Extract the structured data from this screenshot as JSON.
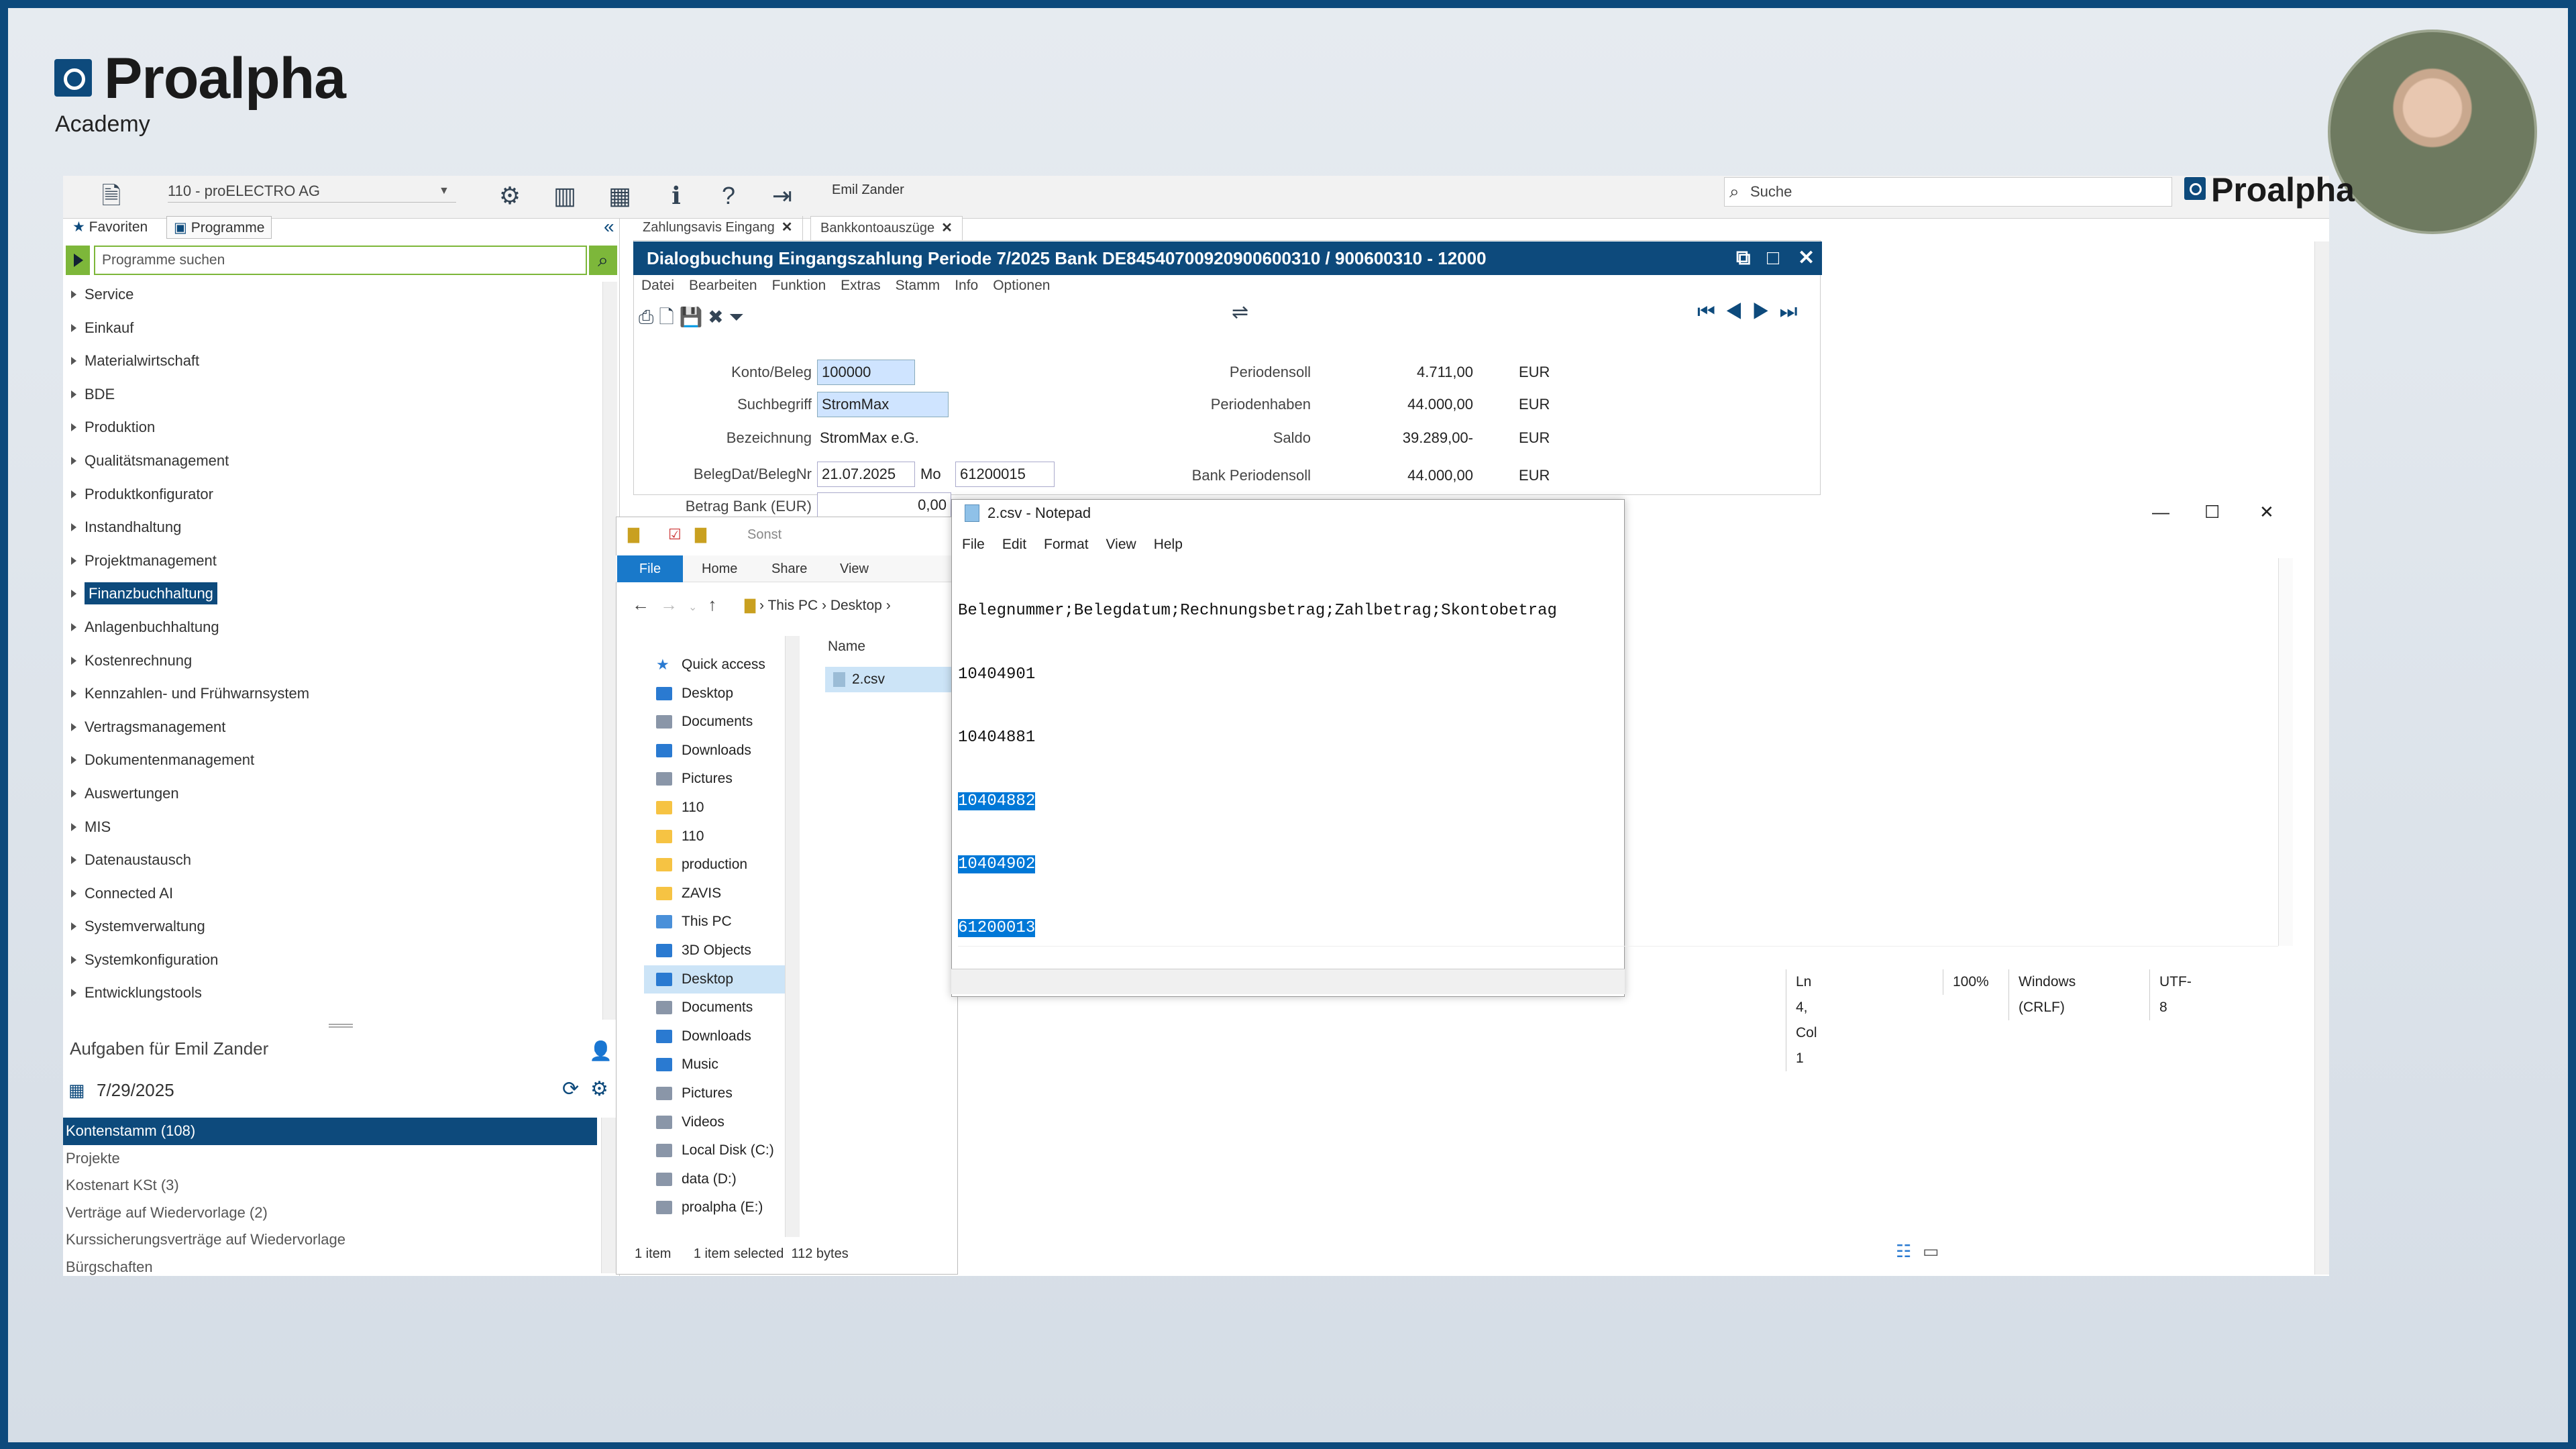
{
  "brand": {
    "name": "Proalpha",
    "sub": "Academy"
  },
  "toolbar": {
    "company": "110 - proELECTRO AG",
    "user": "Emil Zander",
    "search_placeholder": "Suche",
    "brand_small": "Proalpha"
  },
  "left": {
    "tabs": [
      "Favoriten",
      "Programme"
    ],
    "search_placeholder": "Programme suchen",
    "menu": [
      "Service",
      "Einkauf",
      "Materialwirtschaft",
      "BDE",
      "Produktion",
      "Qualitätsmanagement",
      "Produktkonfigurator",
      "Instandhaltung",
      "Projektmanagement",
      "Finanzbuchhaltung",
      "Anlagenbuchhaltung",
      "Kostenrechnung",
      "Kennzahlen- und Frühwarnsystem",
      "Vertragsmanagement",
      "Dokumentenmanagement",
      "Auswertungen",
      "MIS",
      "Datenaustausch",
      "Connected AI",
      "Systemverwaltung",
      "Systemkonfiguration",
      "Entwicklungstools"
    ],
    "selected": "Finanzbuchhaltung",
    "tasks_title": "Aufgaben für Emil Zander",
    "tasks_date": "7/29/2025",
    "tasks": [
      "Kontenstamm (108)",
      "Projekte",
      "Kostenart KSt (3)",
      "Verträge auf Wiedervorlage (2)",
      "Kurssicherungsverträge auf Wiedervorlage",
      "Bürgschaften"
    ]
  },
  "mdi_tabs": [
    "Zahlungsavis Eingang",
    "Bankkontoauszüge"
  ],
  "dialog": {
    "title": "Dialogbuchung Eingangszahlung Periode 7/2025 Bank DE84540700920900600310 / 900600310 - 12000",
    "menu": [
      "Datei",
      "Bearbeiten",
      "Funktion",
      "Extras",
      "Stamm",
      "Info",
      "Optionen"
    ],
    "labels": {
      "konto": "Konto/Beleg",
      "such": "Suchbegriff",
      "bez": "Bezeichnung",
      "beleg": "BelegDat/BelegNr",
      "betrag": "Betrag Bank (EUR)"
    },
    "values": {
      "konto": "100000",
      "such": "StromMax",
      "bez": "StromMax e.G.",
      "date": "21.07.2025",
      "weekday": "Mo",
      "belegnr": "61200015",
      "betrag": "0,00"
    },
    "right": [
      {
        "label": "Periodensoll",
        "value": "4.711,00",
        "cur": "EUR"
      },
      {
        "label": "Periodenhaben",
        "value": "44.000,00",
        "cur": "EUR"
      },
      {
        "label": "Saldo",
        "value": "39.289,00-",
        "cur": "EUR"
      },
      {
        "label": "Bank Periodensoll",
        "value": "44.000,00",
        "cur": "EUR"
      }
    ]
  },
  "explorer": {
    "qat": "Sonst",
    "tabs": [
      "File",
      "Home",
      "Share",
      "View"
    ],
    "path": [
      "This PC",
      "Desktop"
    ],
    "column": "Name",
    "file": "2.csv",
    "tree": [
      {
        "label": "Quick access",
        "icon": "star"
      },
      {
        "label": "Desktop",
        "icon": "blue"
      },
      {
        "label": "Documents",
        "icon": "gray"
      },
      {
        "label": "Downloads",
        "icon": "blue"
      },
      {
        "label": "Pictures",
        "icon": "gray"
      },
      {
        "label": "110",
        "icon": "folder"
      },
      {
        "label": "110",
        "icon": "folder"
      },
      {
        "label": "production",
        "icon": "folder"
      },
      {
        "label": "ZAVIS",
        "icon": "folder"
      },
      {
        "label": "This PC",
        "icon": "gray"
      },
      {
        "label": "3D Objects",
        "icon": "blue"
      },
      {
        "label": "Desktop",
        "icon": "blue"
      },
      {
        "label": "Documents",
        "icon": "gray"
      },
      {
        "label": "Downloads",
        "icon": "blue"
      },
      {
        "label": "Music",
        "icon": "blue"
      },
      {
        "label": "Pictures",
        "icon": "gray"
      },
      {
        "label": "Videos",
        "icon": "gray"
      },
      {
        "label": "Local Disk (C:)",
        "icon": "gray"
      },
      {
        "label": "data (D:)",
        "icon": "gray"
      },
      {
        "label": "proalpha (E:)",
        "icon": "gray"
      }
    ],
    "status": [
      "1 item",
      "1 item selected",
      "112 bytes"
    ]
  },
  "notepad": {
    "title": "2.csv - Notepad",
    "menu": [
      "File",
      "Edit",
      "Format",
      "View",
      "Help"
    ],
    "lines": [
      {
        "text": "Belegnummer;Belegdatum;Rechnungsbetrag;Zahlbetrag;Skontobetrag",
        "selected": false
      },
      {
        "text": "10404901",
        "selected": false
      },
      {
        "text": "10404881",
        "selected": false
      },
      {
        "text": "10404882",
        "selected": true
      },
      {
        "text": "10404902",
        "selected": true
      },
      {
        "text": "61200013",
        "selected": true
      }
    ],
    "status": {
      "pos": "Ln 4, Col 1",
      "zoom": "100%",
      "eol": "Windows (CRLF)",
      "enc": "UTF-8"
    }
  },
  "colors": {
    "accent": "#0d4a7c",
    "green": "#7db73a",
    "selection": "#0078d7"
  }
}
